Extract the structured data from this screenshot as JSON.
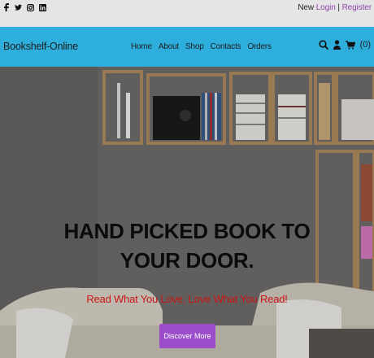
{
  "topbar": {
    "social_icons": [
      "facebook-icon",
      "twitter-icon",
      "instagram-icon",
      "linkedin-icon"
    ],
    "new_label": "New",
    "login_label": "Login",
    "separator": "|",
    "register_label": "Register"
  },
  "header": {
    "brand": "Bookshelf-Online",
    "nav": [
      "Home",
      "About",
      "Shop",
      "Contacts",
      "Orders"
    ],
    "icons": [
      "search-icon",
      "user-icon",
      "cart-icon"
    ],
    "cart_count": "(0)"
  },
  "hero": {
    "title_line1": "HAND PICKED BOOK TO",
    "title_line2": "YOUR DOOR.",
    "subtitle": "Read What You Love, Love What You Read!",
    "cta_label": "Discover More"
  },
  "colors": {
    "header_bg": "#2eaedc",
    "topbar_bg": "#e5e5e5",
    "accent": "#9b4dca",
    "link": "#8e44ad",
    "subtitle": "#cc1515"
  }
}
